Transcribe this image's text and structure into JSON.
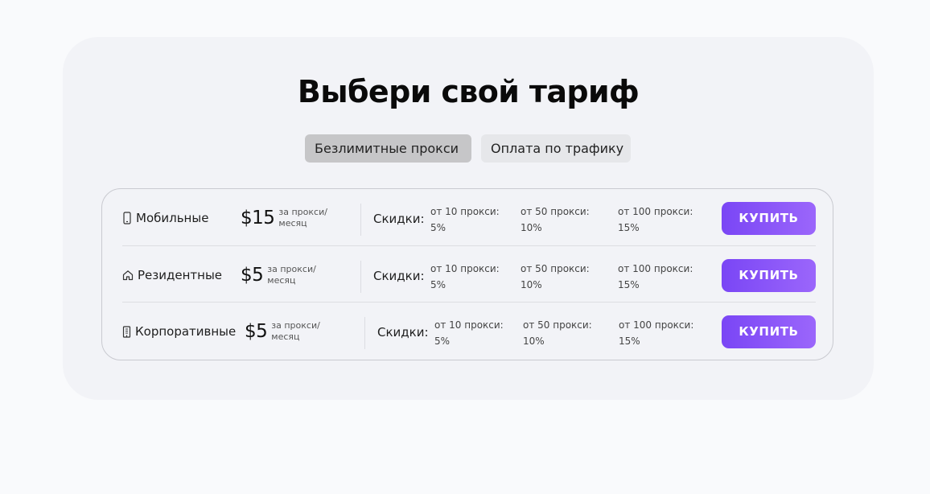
{
  "title": "Выбери свой тариф",
  "tabs": [
    {
      "label": "Безлимитные прокси",
      "active": true
    },
    {
      "label": "Оплата по трафику",
      "active": false
    }
  ],
  "accent_color": "#7a46f5",
  "plans": [
    {
      "icon": "phone-icon",
      "name": "Мобильные",
      "price": "$15",
      "per": "за прокси/ месяц",
      "discounts_label": "Скидки:",
      "tiers": [
        {
          "label": "от 10 прокси:",
          "value": "5%"
        },
        {
          "label": "от 50 прокси:",
          "value": "10%"
        },
        {
          "label": "от 100 прокси:",
          "value": "15%"
        }
      ],
      "buy_label": "КУПИТЬ"
    },
    {
      "icon": "home-icon",
      "name": "Резидентные",
      "price": "$5",
      "per": "за прокси/ месяц",
      "discounts_label": "Скидки:",
      "tiers": [
        {
          "label": "от 10 прокси:",
          "value": "5%"
        },
        {
          "label": "от 50 прокси:",
          "value": "10%"
        },
        {
          "label": "от 100 прокси:",
          "value": "15%"
        }
      ],
      "buy_label": "КУПИТЬ"
    },
    {
      "icon": "building-icon",
      "name": "Корпоративные",
      "price": "$5",
      "per": "за прокси/ месяц",
      "discounts_label": "Скидки:",
      "tiers": [
        {
          "label": "от 10 прокси:",
          "value": "5%"
        },
        {
          "label": "от 50 прокси:",
          "value": "10%"
        },
        {
          "label": "от 100 прокси:",
          "value": "15%"
        }
      ],
      "buy_label": "КУПИТЬ"
    }
  ]
}
